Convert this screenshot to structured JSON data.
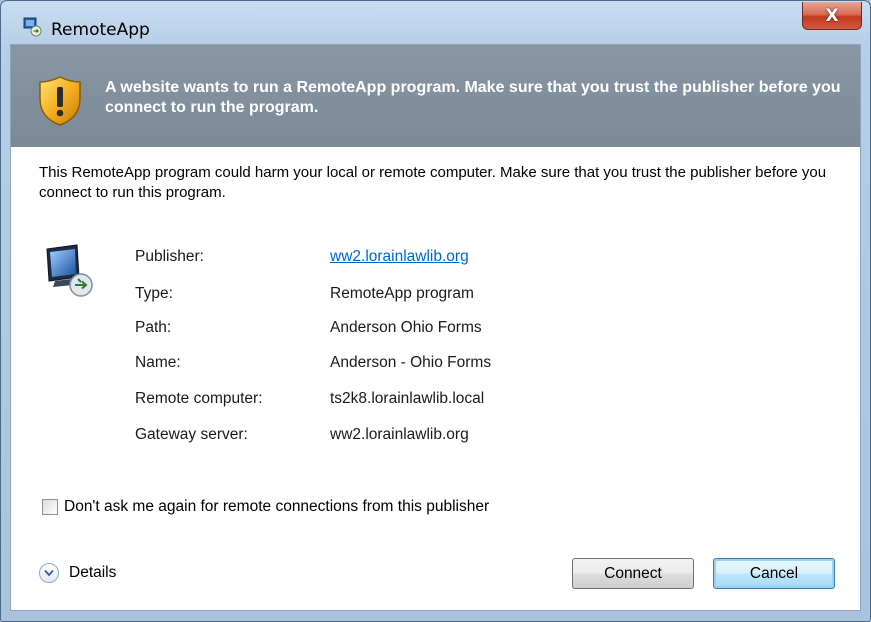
{
  "window": {
    "title": "RemoteApp",
    "close_label": "X"
  },
  "banner": {
    "message": "A website wants to run a RemoteApp program. Make sure that you trust the publisher before you connect to run the program."
  },
  "warning_text": "This RemoteApp program could harm your local or remote computer. Make sure that you trust the publisher before you connect to run this program.",
  "info": {
    "publisher": {
      "label": "Publisher:",
      "value": "ww2.lorainlawlib.org"
    },
    "type": {
      "label": "Type:",
      "value": "RemoteApp program"
    },
    "path": {
      "label": "Path:",
      "value": "Anderson Ohio Forms"
    },
    "name": {
      "label": "Name:",
      "value": "Anderson - Ohio Forms"
    },
    "remote_computer": {
      "label": "Remote computer:",
      "value": "ts2k8.lorainlawlib.local"
    },
    "gateway_server": {
      "label": "Gateway server:",
      "value": "ww2.lorainlawlib.org"
    }
  },
  "checkbox": {
    "label": "Don't ask me again for remote connections from this publisher",
    "checked": false
  },
  "details_label": "Details",
  "buttons": {
    "connect": "Connect",
    "cancel": "Cancel"
  },
  "icons": {
    "title": "remoteapp-icon",
    "shield": "warning-shield-icon",
    "computer": "remote-computer-icon",
    "details": "chevron-down-icon"
  }
}
